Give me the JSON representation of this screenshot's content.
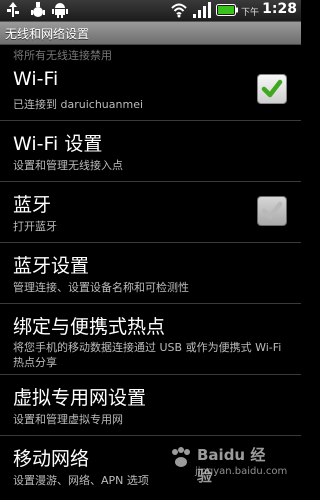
{
  "status_bar": {
    "ampm": "下午",
    "time": "1:28",
    "icons": [
      "usb-icon",
      "debug-icon",
      "android-icon",
      "wifi-icon",
      "signal-icon",
      "battery-icon"
    ]
  },
  "title_bar": {
    "title": "无线和网络设置"
  },
  "cutoff_item": {
    "text": "将所有无线连接禁用"
  },
  "settings": [
    {
      "title": "Wi-Fi",
      "subtitle": "已连接到 daruichuanmei",
      "checked": true,
      "enabled": true
    },
    {
      "title": "Wi-Fi 设置",
      "subtitle": "设置和管理无线接入点"
    },
    {
      "title": "蓝牙",
      "subtitle": "打开蓝牙",
      "checked": true,
      "enabled": false
    },
    {
      "title": "蓝牙设置",
      "subtitle": "管理连接、设置设备名称和可检测性"
    },
    {
      "title": "绑定与便携式热点",
      "subtitle": "将您手机的移动数据连接通过 USB 或作为便携式 Wi-Fi 热点分享"
    },
    {
      "title": "虚拟专用网设置",
      "subtitle": "设置和管理虚拟专用网"
    },
    {
      "title": "移动网络",
      "subtitle": "设置漫游、网络、APN 选项"
    }
  ],
  "watermark": {
    "brand": "Baidu 经验",
    "url": "jingyan.baidu.com"
  },
  "colors": {
    "check_green": "#3fa81e",
    "check_gray": "#b9b9b9"
  }
}
